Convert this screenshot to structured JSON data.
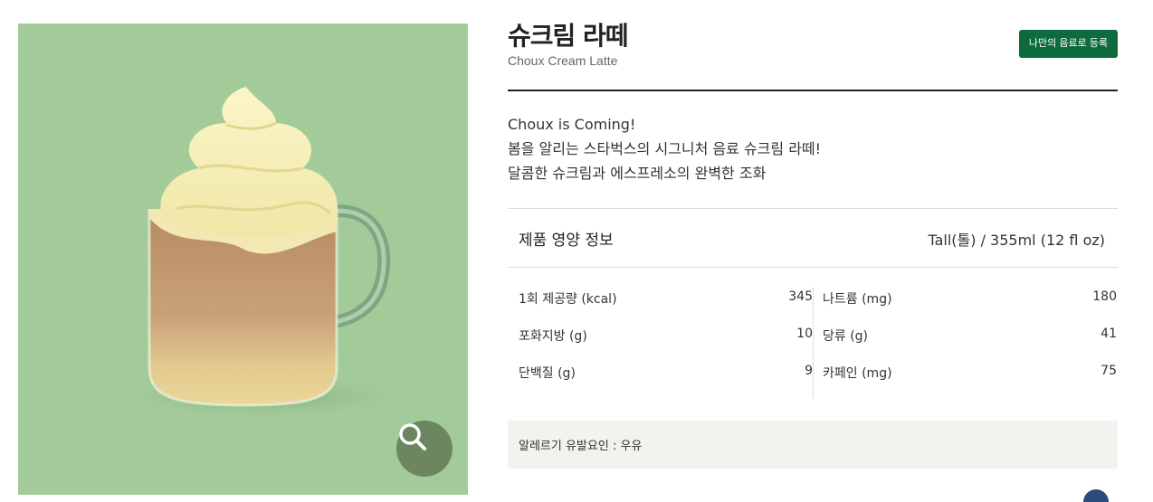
{
  "product": {
    "name_ko": "슈크림 라떼",
    "name_en": "Choux Cream Latte",
    "register_button": "나만의 음료로 등록",
    "description": [
      "Choux is Coming!",
      "봄을 알리는 스타벅스의 시그니처 음료 슈크림 라떼!",
      "달콤한 슈크림과 에스프레소의 완벽한 조화"
    ]
  },
  "image": {
    "background_color": "#a3cb9a",
    "zoom_icon": "magnifier-icon"
  },
  "nutrition": {
    "title": "제품 영양 정보",
    "serving": "Tall(톨) / 355ml (12 fl oz)",
    "left": [
      {
        "label": "1회 제공량 (kcal)",
        "value": "345"
      },
      {
        "label": "포화지방 (g)",
        "value": "10"
      },
      {
        "label": "단백질 (g)",
        "value": "9"
      }
    ],
    "right": [
      {
        "label": "나트륨 (mg)",
        "value": "180"
      },
      {
        "label": "당류 (g)",
        "value": "41"
      },
      {
        "label": "카페인 (mg)",
        "value": "75"
      }
    ]
  },
  "allergy": "알레르기 유발요인 : 우유",
  "colors": {
    "brand_green": "#0d6b3d",
    "zoom_button": "#6c8660"
  }
}
